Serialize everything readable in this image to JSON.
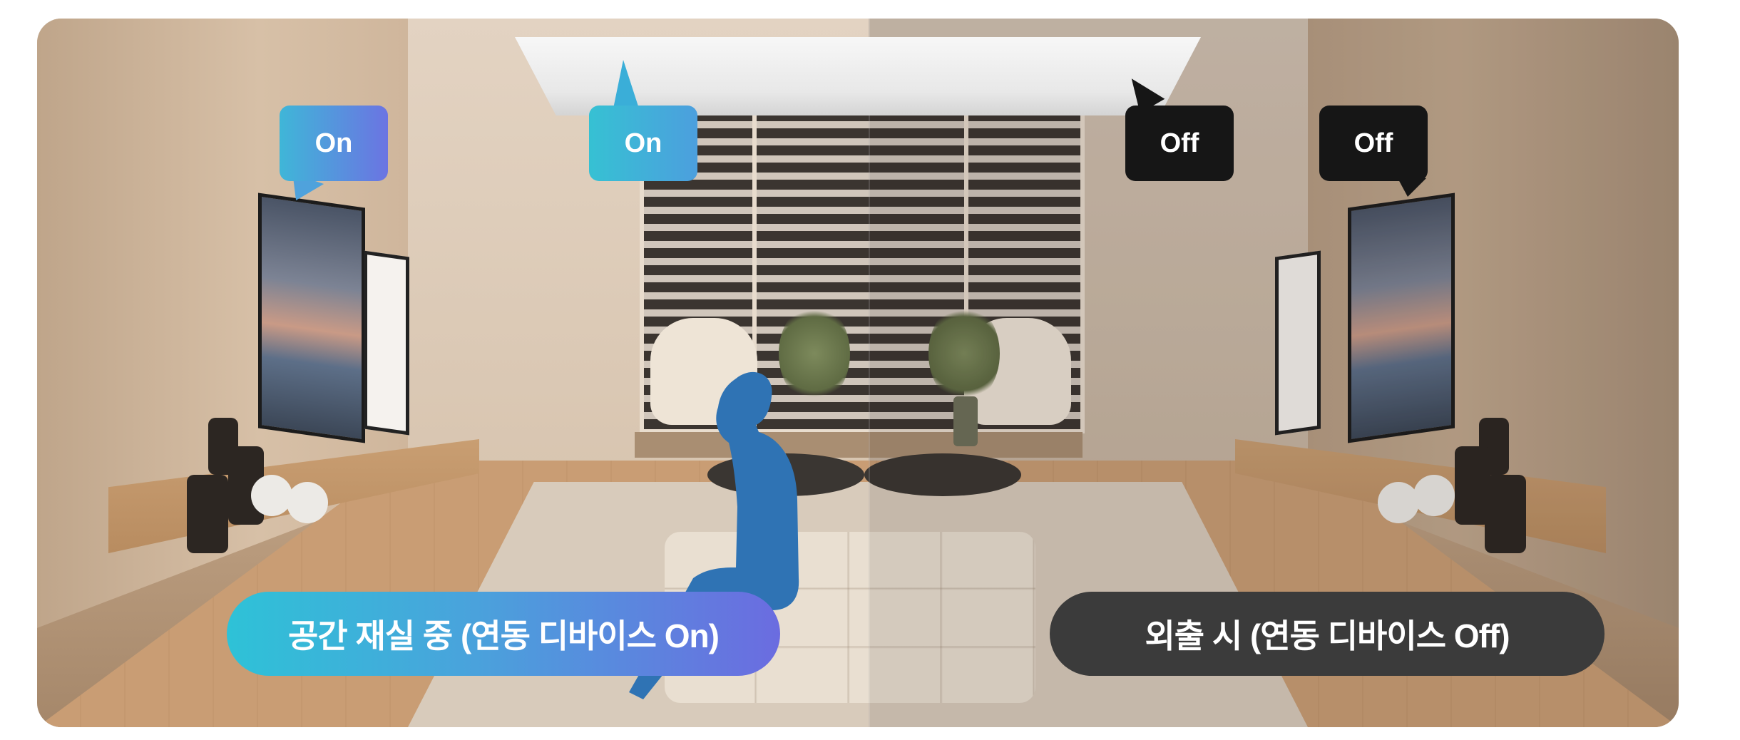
{
  "scene": {
    "left_half_state": "On",
    "right_half_state": "Off"
  },
  "bubbles": {
    "tv_left": "On",
    "ceiling_left": "On",
    "ceiling_right": "Off",
    "tv_right": "Off"
  },
  "labels": {
    "occupied": "공간 재실 중 (연동 디바이스 On)",
    "away": "외출 시 (연동 디바이스 Off)"
  },
  "colors": {
    "on_gradient_start": "#2ec2d7",
    "on_gradient_end": "#6b6ce0",
    "off_bubble": "#161616",
    "off_pill": "#3b3b3b",
    "person_silhouette": "#2f73b4"
  },
  "icons": {
    "ceiling_device": "ceiling-cassette-ac-icon",
    "person": "seated-person-silhouette-icon"
  }
}
